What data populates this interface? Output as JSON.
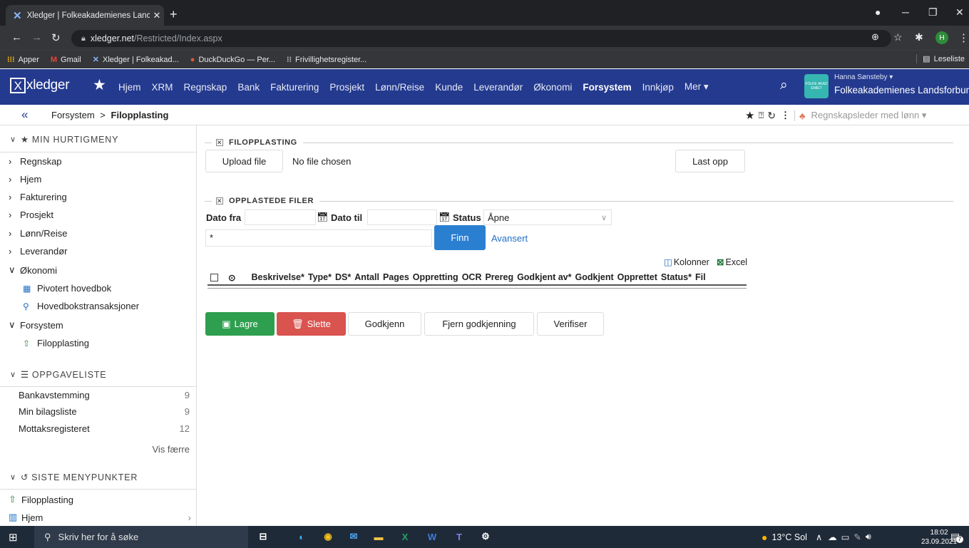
{
  "browser": {
    "tab_title": "Xledger | Folkeakademienes Lanc",
    "url_host": "xledger.net",
    "url_path": "/Restricted/Index.aspx",
    "bookmarks": [
      "Apper",
      "Gmail",
      "Xledger | Folkeakad...",
      "DuckDuckGo — Per...",
      "Frivillighetsregister..."
    ],
    "reading_list": "Leseliste",
    "profile_initial": "H"
  },
  "appnav": {
    "logo_text": "xledger",
    "items": [
      "Hjem",
      "XRM",
      "Regnskap",
      "Bank",
      "Fakturering",
      "Prosjekt",
      "Lønn/Reise",
      "Kunde",
      "Leverandør",
      "Økonomi",
      "Forsystem",
      "Innkjøp",
      "Mer ▾"
    ],
    "active_item": "Forsystem",
    "user_name": "Hanna Sønsteby ▾",
    "org_name": "Folkeakademienes Landsforbund",
    "org_logo_text": "FOLKE AKAD EMIET"
  },
  "breadcrumb": {
    "parent": "Forsystem",
    "separator": ">",
    "current": "Filopplasting",
    "role": "Regnskapsleder med lønn ▾"
  },
  "sidebar": {
    "quickmenu_title": "MIN HURTIGMENY",
    "quickmenu": [
      {
        "label": "Regnskap",
        "open": false
      },
      {
        "label": "Hjem",
        "open": false
      },
      {
        "label": "Fakturering",
        "open": false
      },
      {
        "label": "Prosjekt",
        "open": false
      },
      {
        "label": "Lønn/Reise",
        "open": false
      },
      {
        "label": "Leverandør",
        "open": false
      },
      {
        "label": "Økonomi",
        "open": true
      },
      {
        "label": "Pivotert hovedbok",
        "sub": true
      },
      {
        "label": "Hovedbokstransaksjoner",
        "sub": true
      },
      {
        "label": "Forsystem",
        "open": true
      },
      {
        "label": "Filopplasting",
        "sub": true
      }
    ],
    "tasklist_title": "OPPGAVELISTE",
    "tasks": [
      {
        "label": "Bankavstemming",
        "count": "9"
      },
      {
        "label": "Min bilagsliste",
        "count": "9"
      },
      {
        "label": "Mottaksregisteret",
        "count": "12"
      }
    ],
    "show_fewer": "Vis færre",
    "recent_title": "SISTE MENYPUNKTER",
    "recent": [
      "Filopplasting",
      "Hjem"
    ]
  },
  "main": {
    "upload_section": "FILOPPLASTING",
    "upload_button": "Upload file",
    "no_file": "No file chosen",
    "last_opp": "Last opp",
    "files_section": "OPPLASTEDE FILER",
    "dato_fra": "Dato fra",
    "dato_til": "Dato til",
    "status_label": "Status",
    "status_value": "Åpne",
    "search_value": "*",
    "finn": "Finn",
    "avansert": "Avansert",
    "kolonner": "Kolonner",
    "excel": "Excel",
    "columns": [
      "Beskrivelse*",
      "Type*",
      "DS*",
      "Antall",
      "Pages",
      "Oppretting",
      "OCR",
      "Prereg",
      "Godkjent av*",
      "Godkjent",
      "Opprettet",
      "Status*",
      "Fil"
    ],
    "lagre": "Lagre",
    "slette": "Slette",
    "godkjenn": "Godkjenn",
    "fjern": "Fjern godkjenning",
    "verifiser": "Verifiser"
  },
  "taskbar": {
    "search_placeholder": "Skriv her for å søke",
    "weather": "13°C Sol",
    "time": "18:02",
    "date": "23.09.2021",
    "notif_count": "7"
  },
  "colors": {
    "nav_bg": "#243a8f",
    "save_green": "#2e9e4f",
    "delete_red": "#d9534f",
    "finn_blue": "#2b7fd1"
  }
}
